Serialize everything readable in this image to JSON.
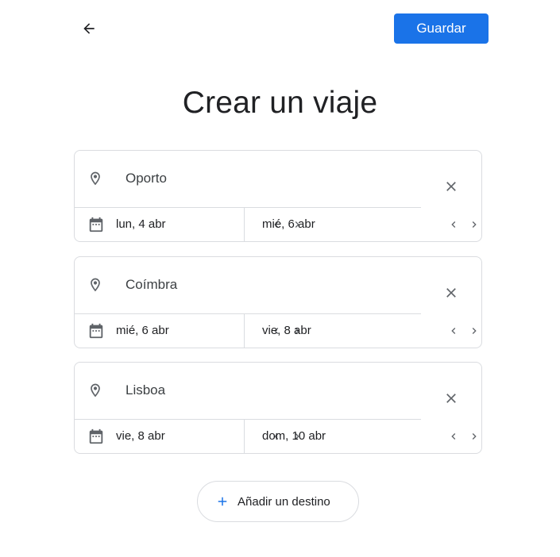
{
  "header": {
    "back_icon": "arrow-left-icon",
    "save_label": "Guardar",
    "accent_color": "#1a73e8"
  },
  "title": "Crear un viaje",
  "destinations": [
    {
      "name": "Oporto",
      "start_date": "lun, 4 abr",
      "end_date": "mié, 6 abr"
    },
    {
      "name": "Coímbra",
      "start_date": "mié, 6 abr",
      "end_date": "vie, 8 abr"
    },
    {
      "name": "Lisboa",
      "start_date": "vie, 8 abr",
      "end_date": "dom, 10 abr"
    }
  ],
  "add_destination_label": "Añadir un destino",
  "icons": {
    "place": "map-pin-icon",
    "calendar": "calendar-icon",
    "prev": "chevron-left-icon",
    "next": "chevron-right-icon",
    "remove": "close-icon",
    "add": "plus-icon"
  }
}
